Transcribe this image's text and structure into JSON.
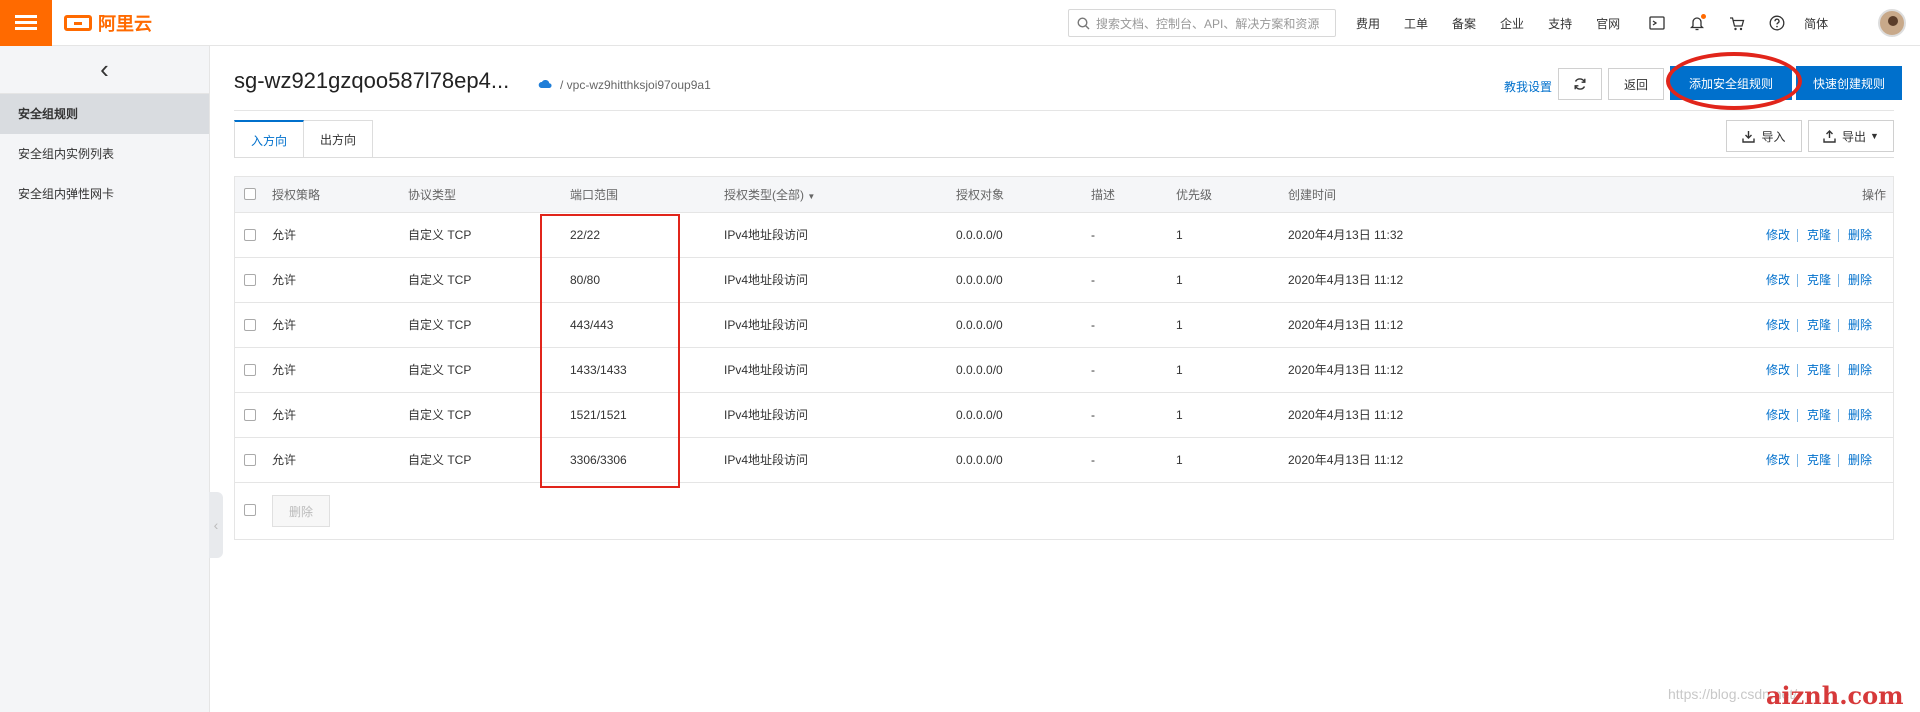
{
  "topbar": {
    "logo_text": "阿里云",
    "search_placeholder": "搜索文档、控制台、API、解决方案和资源",
    "nav": [
      "费用",
      "工单",
      "备案",
      "企业",
      "支持",
      "官网"
    ],
    "lang": "简体"
  },
  "sidebar": {
    "back_glyph": "‹",
    "items": [
      {
        "label": "安全组规则"
      },
      {
        "label": "安全组内实例列表"
      },
      {
        "label": "安全组内弹性网卡"
      }
    ]
  },
  "header": {
    "sg_id": "sg-wz921gzqoo587l78ep4...",
    "vpc": "/ vpc-wz9hitthksjoi97oup9a1",
    "teach_label": "教我设置",
    "back_label": "返回",
    "add_rule_label": "添加安全组规则",
    "quick_create_label": "快速创建规则",
    "import_label": "导入",
    "export_label": "导出"
  },
  "tabs": [
    {
      "label": "入方向"
    },
    {
      "label": "出方向"
    }
  ],
  "table": {
    "headers": {
      "policy": "授权策略",
      "protocol": "协议类型",
      "port": "端口范围",
      "auth_type": "授权类型(全部)",
      "auth_object": "授权对象",
      "desc": "描述",
      "priority": "优先级",
      "created": "创建时间",
      "ops": "操作"
    },
    "rows": [
      {
        "policy": "允许",
        "protocol": "自定义 TCP",
        "port": "22/22",
        "auth_type": "IPv4地址段访问",
        "auth_object": "0.0.0.0/0",
        "desc": "-",
        "priority": "1",
        "created": "2020年4月13日 11:32"
      },
      {
        "policy": "允许",
        "protocol": "自定义 TCP",
        "port": "80/80",
        "auth_type": "IPv4地址段访问",
        "auth_object": "0.0.0.0/0",
        "desc": "-",
        "priority": "1",
        "created": "2020年4月13日 11:12"
      },
      {
        "policy": "允许",
        "protocol": "自定义 TCP",
        "port": "443/443",
        "auth_type": "IPv4地址段访问",
        "auth_object": "0.0.0.0/0",
        "desc": "-",
        "priority": "1",
        "created": "2020年4月13日 11:12"
      },
      {
        "policy": "允许",
        "protocol": "自定义 TCP",
        "port": "1433/1433",
        "auth_type": "IPv4地址段访问",
        "auth_object": "0.0.0.0/0",
        "desc": "-",
        "priority": "1",
        "created": "2020年4月13日 11:12"
      },
      {
        "policy": "允许",
        "protocol": "自定义 TCP",
        "port": "1521/1521",
        "auth_type": "IPv4地址段访问",
        "auth_object": "0.0.0.0/0",
        "desc": "-",
        "priority": "1",
        "created": "2020年4月13日 11:12"
      },
      {
        "policy": "允许",
        "protocol": "自定义 TCP",
        "port": "3306/3306",
        "auth_type": "IPv4地址段访问",
        "auth_object": "0.0.0.0/0",
        "desc": "-",
        "priority": "1",
        "created": "2020年4月13日 11:12"
      }
    ],
    "row_actions": {
      "edit": "修改",
      "clone": "克隆",
      "delete": "删除"
    },
    "bulk_delete_label": "删除"
  },
  "watermark": {
    "blog": "https://blog.csdn.net/",
    "site": "aiznh.com"
  },
  "colors": {
    "brand_orange": "#ff6a00",
    "primary_blue": "#0070cc",
    "annotation_red": "#e1251b"
  }
}
